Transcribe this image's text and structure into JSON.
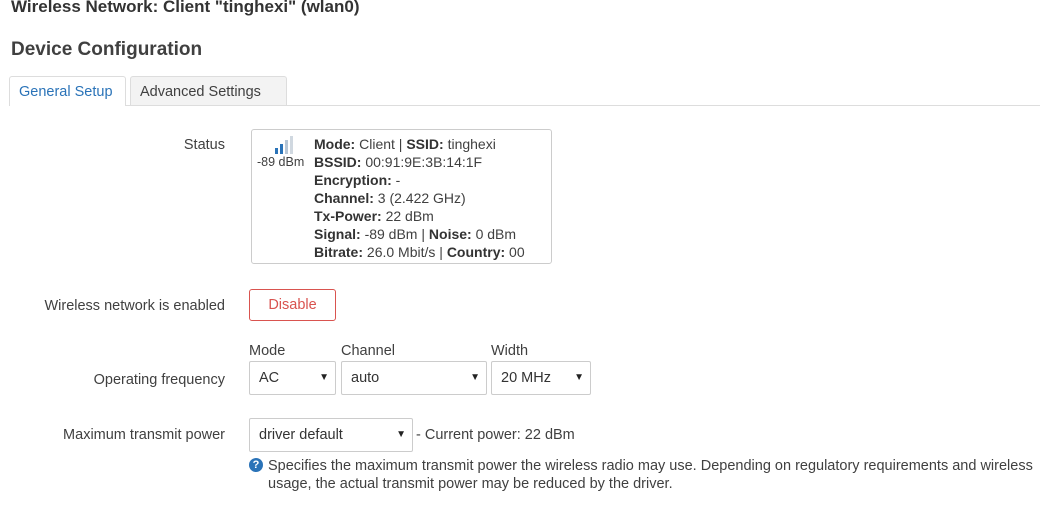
{
  "header": {
    "page_title": "Wireless Network: Client \"tinghexi\" (wlan0)",
    "section_title": "Device Configuration"
  },
  "tabs": [
    {
      "label": "General Setup",
      "active": true
    },
    {
      "label": "Advanced Settings",
      "active": false
    }
  ],
  "status": {
    "label": "Status",
    "signal_icon": "signal-strength-icon",
    "signal_dbm": "-89 dBm",
    "mode_key": "Mode:",
    "mode_value": "Client",
    "ssid_key": "SSID:",
    "ssid_value": "tinghexi",
    "bssid_key": "BSSID:",
    "bssid_value": "00:91:9E:3B:14:1F",
    "encryption_key": "Encryption:",
    "encryption_value": "-",
    "channel_key": "Channel:",
    "channel_value": "3 (2.422 GHz)",
    "txpower_key": "Tx-Power:",
    "txpower_value": "22 dBm",
    "signal_key": "Signal:",
    "signal_value": "-89 dBm",
    "noise_key": "Noise:",
    "noise_value": "0 dBm",
    "bitrate_key": "Bitrate:",
    "bitrate_value": "26.0 Mbit/s",
    "country_key": "Country:",
    "country_value": "00",
    "separator": "|"
  },
  "enabled": {
    "label": "Wireless network is enabled",
    "button_label": "Disable",
    "button_color": "#d9534f"
  },
  "frequency": {
    "label": "Operating frequency",
    "mode_header": "Mode",
    "mode_value": "AC",
    "channel_header": "Channel",
    "channel_value": "auto",
    "width_header": "Width",
    "width_value": "20 MHz"
  },
  "txpower": {
    "label": "Maximum transmit power",
    "value": "driver default",
    "current_note": "- Current power: 22 dBm",
    "help_icon": "question-circle-icon",
    "help_text": "Specifies the maximum transmit power the wireless radio may use. Depending on regulatory requirements and wireless usage, the actual transmit power may be reduced by the driver."
  },
  "colors": {
    "accent": "#2a73b8",
    "danger": "#d9534f",
    "text": "#404040"
  }
}
